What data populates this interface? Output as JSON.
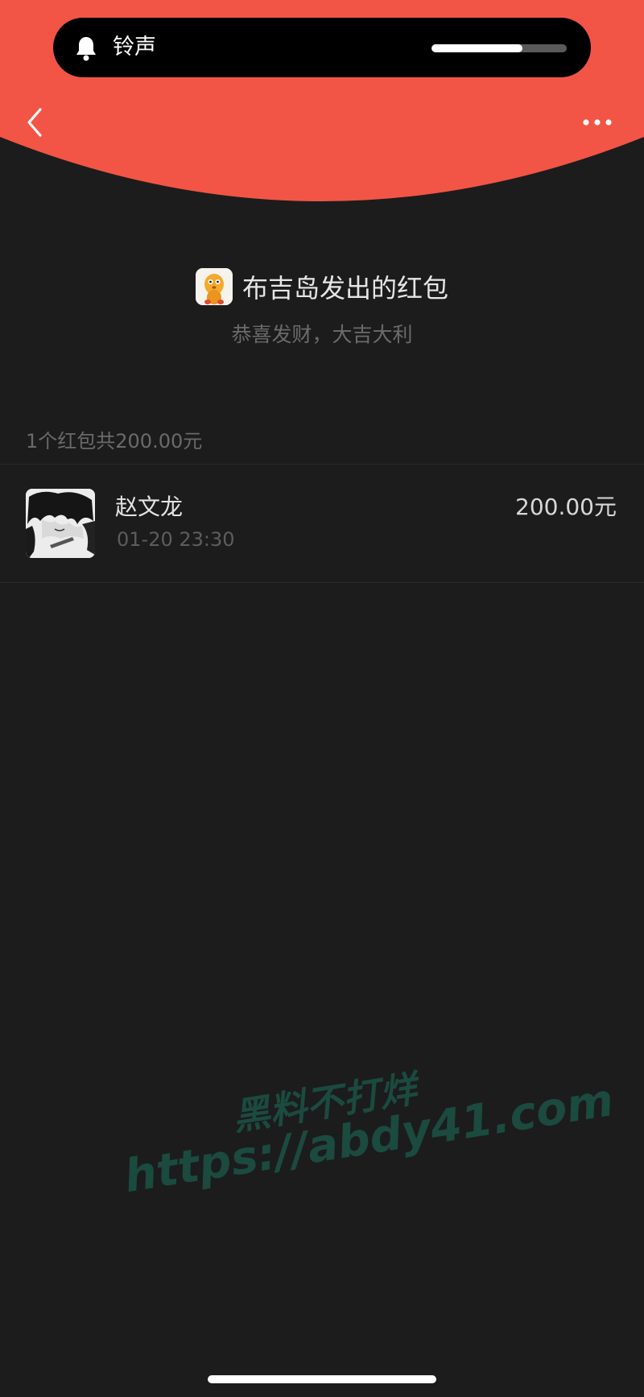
{
  "colors": {
    "header_red": "#f25545",
    "background": "#1c1c1c",
    "watermark": "#1b4a3f"
  },
  "system_banner": {
    "icon": "bell-icon",
    "label": "铃声",
    "volume_level": 0.67
  },
  "nav": {
    "back_icon": "chevron-left-icon",
    "more_icon": "more-dots-icon"
  },
  "packet": {
    "sender_title": "布吉岛发出的红包",
    "greeting": "恭喜发财，大吉大利",
    "summary": "1个红包共200.00元"
  },
  "records": [
    {
      "name": "赵文龙",
      "time": "01-20 23:30",
      "amount": "200.00元"
    }
  ],
  "watermark": {
    "line1": "黑料不打烊",
    "line2": "https://abdy41.com"
  }
}
